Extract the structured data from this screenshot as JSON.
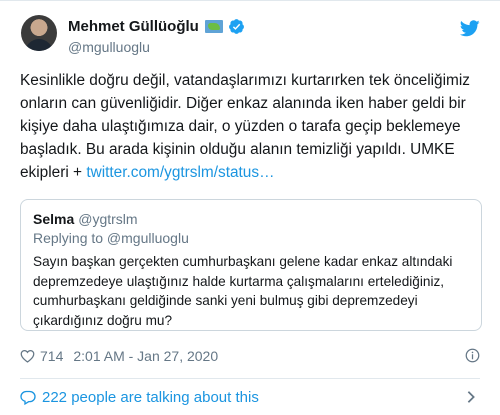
{
  "author": {
    "display_name": "Mehmet Güllüoğlu",
    "handle": "@mgulluoglu",
    "flag_icon": "world-map-emoji",
    "verified_icon": "verified-badge-icon",
    "verified_color": "#1da1f2"
  },
  "tweet": {
    "text_main": "Kesinlikle doğru değil, vatandaşlarımızı kurtarırken tek önceliğimiz onların can güvenliğidir. Diğer enkaz alanında iken haber geldi bir kişiye daha ulaştığımıza dair, o yüzden o tarafa geçip beklemeye başladık. Bu arada kişinin olduğu alanın temizliği yapıldı. UMKE ekipleri + ",
    "link_text": "twitter.com/ygtrslm/status…",
    "link_color": "#1b95e0"
  },
  "quoted": {
    "name": "Selma",
    "handle": "@ygtrslm",
    "replying_to": "Replying to @mgulluoglu",
    "text": "Sayın başkan gerçekten cumhurbaşkanı gelene kadar enkaz altındaki depremzedeye ulaştığınız halde kurtarma çalışmalarını ertelediğiniz, cumhurbaşkanı geldiğinde sanki yeni bulmuş gibi depremzedeyi çıkardığınız doğru mu?"
  },
  "meta": {
    "like_count": "714",
    "timestamp": "2:01 AM - Jan 27, 2020"
  },
  "footer": {
    "talking_text": "222 people are talking about this"
  },
  "icons": {
    "bird": "twitter-bird-icon",
    "heart": "heart-icon",
    "info": "info-icon",
    "bubble": "speech-bubble-icon",
    "chevron": "chevron-right-icon"
  },
  "colors": {
    "accent": "#1b95e0",
    "muted": "#657786",
    "border": "#ccd6dd"
  }
}
